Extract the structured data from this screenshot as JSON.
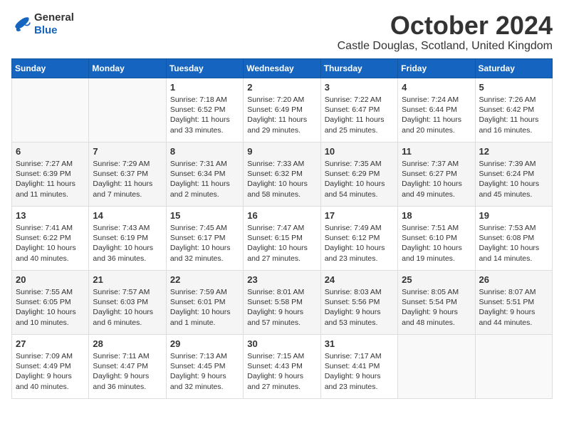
{
  "header": {
    "logo_general": "General",
    "logo_blue": "Blue",
    "month": "October 2024",
    "location": "Castle Douglas, Scotland, United Kingdom"
  },
  "weekdays": [
    "Sunday",
    "Monday",
    "Tuesday",
    "Wednesday",
    "Thursday",
    "Friday",
    "Saturday"
  ],
  "weeks": [
    [
      {
        "day": "",
        "lines": []
      },
      {
        "day": "",
        "lines": []
      },
      {
        "day": "1",
        "lines": [
          "Sunrise: 7:18 AM",
          "Sunset: 6:52 PM",
          "Daylight: 11 hours",
          "and 33 minutes."
        ]
      },
      {
        "day": "2",
        "lines": [
          "Sunrise: 7:20 AM",
          "Sunset: 6:49 PM",
          "Daylight: 11 hours",
          "and 29 minutes."
        ]
      },
      {
        "day": "3",
        "lines": [
          "Sunrise: 7:22 AM",
          "Sunset: 6:47 PM",
          "Daylight: 11 hours",
          "and 25 minutes."
        ]
      },
      {
        "day": "4",
        "lines": [
          "Sunrise: 7:24 AM",
          "Sunset: 6:44 PM",
          "Daylight: 11 hours",
          "and 20 minutes."
        ]
      },
      {
        "day": "5",
        "lines": [
          "Sunrise: 7:26 AM",
          "Sunset: 6:42 PM",
          "Daylight: 11 hours",
          "and 16 minutes."
        ]
      }
    ],
    [
      {
        "day": "6",
        "lines": [
          "Sunrise: 7:27 AM",
          "Sunset: 6:39 PM",
          "Daylight: 11 hours",
          "and 11 minutes."
        ]
      },
      {
        "day": "7",
        "lines": [
          "Sunrise: 7:29 AM",
          "Sunset: 6:37 PM",
          "Daylight: 11 hours",
          "and 7 minutes."
        ]
      },
      {
        "day": "8",
        "lines": [
          "Sunrise: 7:31 AM",
          "Sunset: 6:34 PM",
          "Daylight: 11 hours",
          "and 2 minutes."
        ]
      },
      {
        "day": "9",
        "lines": [
          "Sunrise: 7:33 AM",
          "Sunset: 6:32 PM",
          "Daylight: 10 hours",
          "and 58 minutes."
        ]
      },
      {
        "day": "10",
        "lines": [
          "Sunrise: 7:35 AM",
          "Sunset: 6:29 PM",
          "Daylight: 10 hours",
          "and 54 minutes."
        ]
      },
      {
        "day": "11",
        "lines": [
          "Sunrise: 7:37 AM",
          "Sunset: 6:27 PM",
          "Daylight: 10 hours",
          "and 49 minutes."
        ]
      },
      {
        "day": "12",
        "lines": [
          "Sunrise: 7:39 AM",
          "Sunset: 6:24 PM",
          "Daylight: 10 hours",
          "and 45 minutes."
        ]
      }
    ],
    [
      {
        "day": "13",
        "lines": [
          "Sunrise: 7:41 AM",
          "Sunset: 6:22 PM",
          "Daylight: 10 hours",
          "and 40 minutes."
        ]
      },
      {
        "day": "14",
        "lines": [
          "Sunrise: 7:43 AM",
          "Sunset: 6:19 PM",
          "Daylight: 10 hours",
          "and 36 minutes."
        ]
      },
      {
        "day": "15",
        "lines": [
          "Sunrise: 7:45 AM",
          "Sunset: 6:17 PM",
          "Daylight: 10 hours",
          "and 32 minutes."
        ]
      },
      {
        "day": "16",
        "lines": [
          "Sunrise: 7:47 AM",
          "Sunset: 6:15 PM",
          "Daylight: 10 hours",
          "and 27 minutes."
        ]
      },
      {
        "day": "17",
        "lines": [
          "Sunrise: 7:49 AM",
          "Sunset: 6:12 PM",
          "Daylight: 10 hours",
          "and 23 minutes."
        ]
      },
      {
        "day": "18",
        "lines": [
          "Sunrise: 7:51 AM",
          "Sunset: 6:10 PM",
          "Daylight: 10 hours",
          "and 19 minutes."
        ]
      },
      {
        "day": "19",
        "lines": [
          "Sunrise: 7:53 AM",
          "Sunset: 6:08 PM",
          "Daylight: 10 hours",
          "and 14 minutes."
        ]
      }
    ],
    [
      {
        "day": "20",
        "lines": [
          "Sunrise: 7:55 AM",
          "Sunset: 6:05 PM",
          "Daylight: 10 hours",
          "and 10 minutes."
        ]
      },
      {
        "day": "21",
        "lines": [
          "Sunrise: 7:57 AM",
          "Sunset: 6:03 PM",
          "Daylight: 10 hours",
          "and 6 minutes."
        ]
      },
      {
        "day": "22",
        "lines": [
          "Sunrise: 7:59 AM",
          "Sunset: 6:01 PM",
          "Daylight: 10 hours",
          "and 1 minute."
        ]
      },
      {
        "day": "23",
        "lines": [
          "Sunrise: 8:01 AM",
          "Sunset: 5:58 PM",
          "Daylight: 9 hours",
          "and 57 minutes."
        ]
      },
      {
        "day": "24",
        "lines": [
          "Sunrise: 8:03 AM",
          "Sunset: 5:56 PM",
          "Daylight: 9 hours",
          "and 53 minutes."
        ]
      },
      {
        "day": "25",
        "lines": [
          "Sunrise: 8:05 AM",
          "Sunset: 5:54 PM",
          "Daylight: 9 hours",
          "and 48 minutes."
        ]
      },
      {
        "day": "26",
        "lines": [
          "Sunrise: 8:07 AM",
          "Sunset: 5:51 PM",
          "Daylight: 9 hours",
          "and 44 minutes."
        ]
      }
    ],
    [
      {
        "day": "27",
        "lines": [
          "Sunrise: 7:09 AM",
          "Sunset: 4:49 PM",
          "Daylight: 9 hours",
          "and 40 minutes."
        ]
      },
      {
        "day": "28",
        "lines": [
          "Sunrise: 7:11 AM",
          "Sunset: 4:47 PM",
          "Daylight: 9 hours",
          "and 36 minutes."
        ]
      },
      {
        "day": "29",
        "lines": [
          "Sunrise: 7:13 AM",
          "Sunset: 4:45 PM",
          "Daylight: 9 hours",
          "and 32 minutes."
        ]
      },
      {
        "day": "30",
        "lines": [
          "Sunrise: 7:15 AM",
          "Sunset: 4:43 PM",
          "Daylight: 9 hours",
          "and 27 minutes."
        ]
      },
      {
        "day": "31",
        "lines": [
          "Sunrise: 7:17 AM",
          "Sunset: 4:41 PM",
          "Daylight: 9 hours",
          "and 23 minutes."
        ]
      },
      {
        "day": "",
        "lines": []
      },
      {
        "day": "",
        "lines": []
      }
    ]
  ]
}
